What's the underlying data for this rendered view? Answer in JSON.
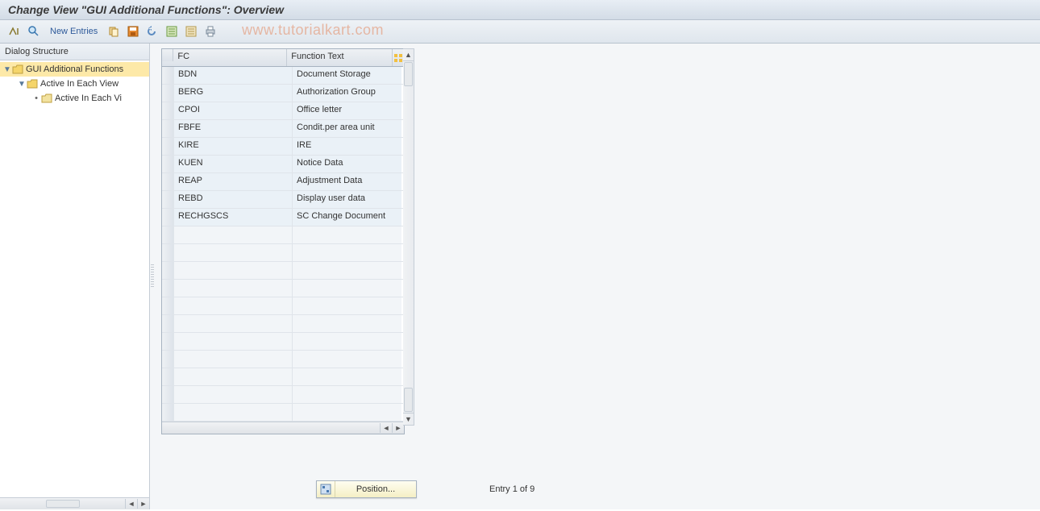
{
  "title": "Change View \"GUI Additional Functions\": Overview",
  "watermark": "www.tutorialkart.com",
  "toolbar": {
    "new_entries_label": "New Entries"
  },
  "sidebar": {
    "header": "Dialog Structure",
    "nodes": [
      {
        "label": "GUI Additional Functions",
        "level": 0,
        "open": true,
        "selected": true,
        "hasChildren": true
      },
      {
        "label": "Active In Each View",
        "level": 1,
        "open": true,
        "selected": false,
        "hasChildren": true
      },
      {
        "label": "Active In Each Vi",
        "level": 2,
        "open": false,
        "selected": false,
        "hasChildren": false
      }
    ]
  },
  "grid": {
    "columns": {
      "fc": "FC",
      "functionText": "Function Text"
    },
    "rows": [
      {
        "fc": "BDN",
        "ft": "Document Storage"
      },
      {
        "fc": "BERG",
        "ft": "Authorization Group"
      },
      {
        "fc": "CPOI",
        "ft": "Office letter"
      },
      {
        "fc": "FBFE",
        "ft": "Condit.per area unit"
      },
      {
        "fc": "KIRE",
        "ft": "IRE"
      },
      {
        "fc": "KUEN",
        "ft": "Notice Data"
      },
      {
        "fc": "REAP",
        "ft": "Adjustment Data"
      },
      {
        "fc": "REBD",
        "ft": "Display user data"
      },
      {
        "fc": "RECHGSCS",
        "ft": "SC Change Document"
      }
    ],
    "emptyRows": 11
  },
  "footer": {
    "position_label": "Position...",
    "status": "Entry 1 of 9"
  }
}
